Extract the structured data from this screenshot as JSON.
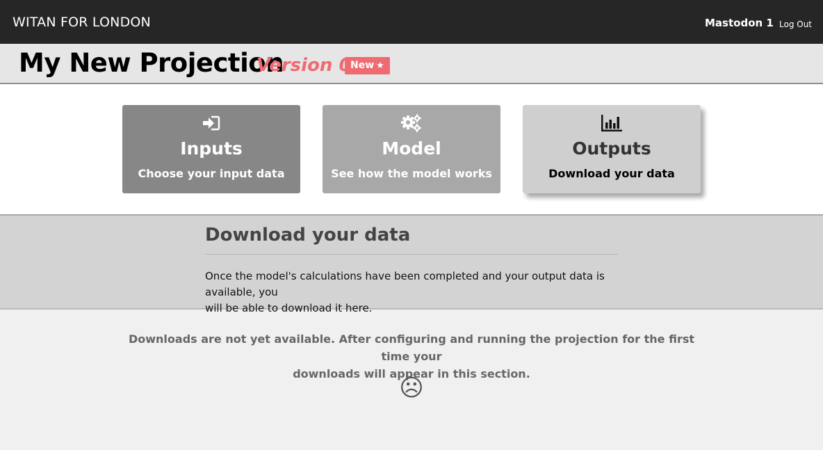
{
  "navbar": {
    "brand": "WITAN FOR LONDON",
    "user": "Mastodon 1",
    "logout": "Log Out"
  },
  "projection": {
    "title": "My New Projection",
    "version": "Version 0",
    "badge": "New"
  },
  "cards": {
    "inputs": {
      "title": "Inputs",
      "subtitle": "Choose your input data",
      "icon": "sign-in-icon"
    },
    "model": {
      "title": "Model",
      "subtitle": "See how the model works",
      "icon": "gears-icon"
    },
    "outputs": {
      "title": "Outputs",
      "subtitle": "Download your data",
      "icon": "bar-chart-icon",
      "active": true
    }
  },
  "section": {
    "heading": "Download your data",
    "text_line1": "Once the model's calculations have been completed and your output data is available, you",
    "text_line2": "will be able to download it here."
  },
  "empty_state": {
    "line1": "Downloads are not yet available. After configuring and running the projection for the first time your",
    "line2": "downloads will appear in this section.",
    "icon": "frown-icon"
  },
  "colors": {
    "accent": "#ef6b72",
    "navbar": "#262626"
  }
}
